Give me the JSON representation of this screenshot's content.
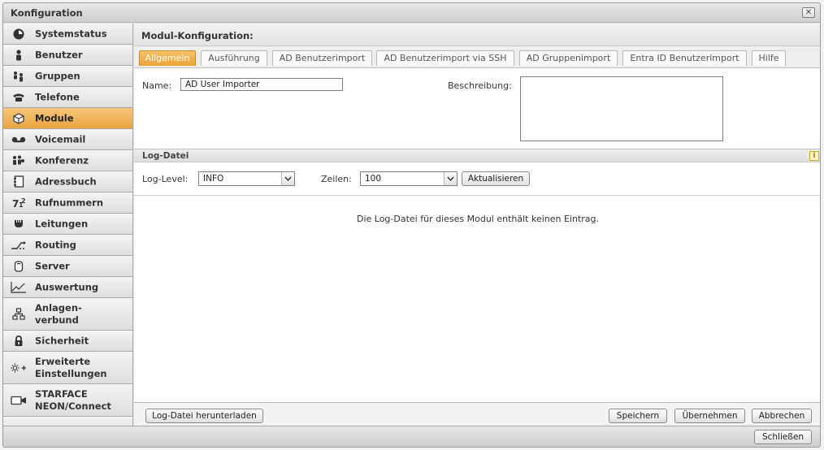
{
  "window": {
    "title": "Konfiguration",
    "close_symbol": "✕"
  },
  "sidebar": {
    "items": [
      {
        "label": "Systemstatus",
        "icon": "dashboard-icon"
      },
      {
        "label": "Benutzer",
        "icon": "user-icon"
      },
      {
        "label": "Gruppen",
        "icon": "group-icon"
      },
      {
        "label": "Telefone",
        "icon": "phone-icon"
      },
      {
        "label": "Module",
        "icon": "module-icon",
        "active": true
      },
      {
        "label": "Voicemail",
        "icon": "voicemail-icon"
      },
      {
        "label": "Konferenz",
        "icon": "conference-icon"
      },
      {
        "label": "Adressbuch",
        "icon": "addressbook-icon"
      },
      {
        "label": "Rufnummern",
        "icon": "numbers-icon"
      },
      {
        "label": "Leitungen",
        "icon": "lines-icon"
      },
      {
        "label": "Routing",
        "icon": "routing-icon"
      },
      {
        "label": "Server",
        "icon": "server-icon"
      },
      {
        "label": "Auswertung",
        "icon": "chart-icon"
      },
      {
        "label_1": "Anlagen-",
        "label_2": "verbund",
        "icon": "network-icon"
      },
      {
        "label": "Sicherheit",
        "icon": "lock-icon"
      },
      {
        "label_1": "Erweiterte",
        "label_2": "Einstellungen",
        "icon": "settings-plus-icon"
      },
      {
        "label_1": "STARFACE",
        "label_2": "NEON/Connect",
        "icon": "camera-icon"
      }
    ]
  },
  "main": {
    "header": "Modul-Konfiguration:",
    "tabs": [
      "Allgemein",
      "Ausführung",
      "AD Benutzerimport",
      "AD Benutzerimport via SSH",
      "AD Gruppenimport",
      "Entra ID Benutzerimport",
      "Hilfe"
    ],
    "form": {
      "name_label": "Name:",
      "name_value": "AD User Importer",
      "description_label": "Beschreibung:"
    },
    "log": {
      "section_title": "Log-Datei",
      "info_symbol": "i",
      "level_label": "Log-Level:",
      "level_value": "INFO",
      "lines_label": "Zeilen:",
      "lines_value": "100",
      "refresh_button": "Aktualisieren",
      "empty_message": "Die Log-Datei für dieses Modul enthält keinen Eintrag."
    },
    "bottom": {
      "download_button": "Log-Datei herunterladen",
      "save_button": "Speichern",
      "apply_button": "Übernehmen",
      "cancel_button": "Abbrechen"
    }
  },
  "footer": {
    "close_button": "Schließen"
  },
  "colors": {
    "accent": "#eaa436",
    "active_nav": "#f0b65a"
  }
}
